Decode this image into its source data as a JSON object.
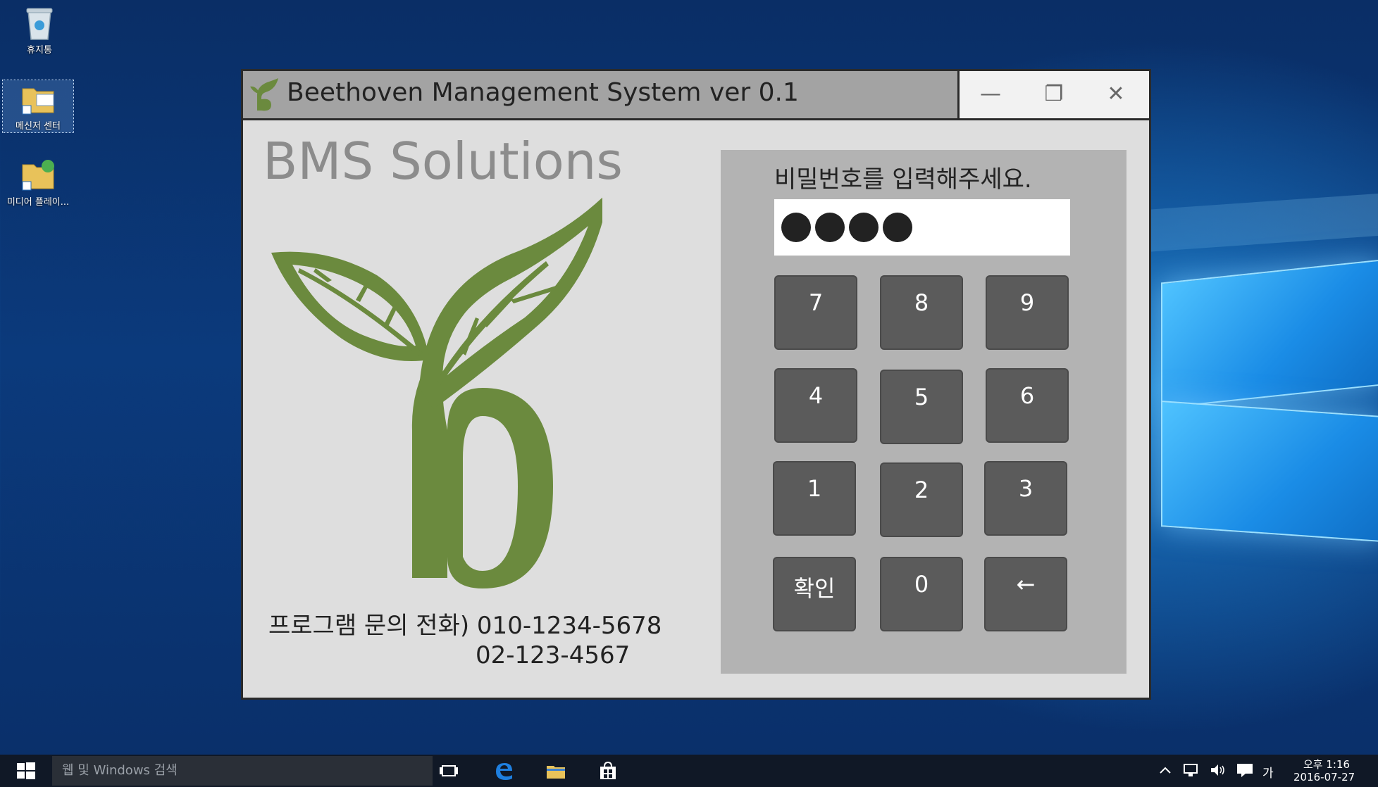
{
  "desktop": {
    "icons": [
      {
        "label": "휴지통",
        "icon": "recycle-bin-icon"
      },
      {
        "label": "메신저 센터",
        "icon": "folder-shortcut-icon"
      },
      {
        "label": "미디어 플레이...",
        "icon": "media-folder-icon"
      }
    ]
  },
  "window": {
    "title": "Beethoven Management System ver 0.1",
    "controls": {
      "minimize": "—",
      "restore": "❐",
      "close": "✕"
    },
    "brand": "BMS Solutions",
    "contact_label": "프로그램 문의 전화) 010-1234-5678",
    "contact_number_2": "02-123-4567",
    "pad": {
      "prompt": "비밀번호를 입력해주세요.",
      "password_dots": 4,
      "keys": [
        {
          "label": "7"
        },
        {
          "label": "8"
        },
        {
          "label": "9"
        },
        {
          "label": "4"
        },
        {
          "label": "5"
        },
        {
          "label": "6"
        },
        {
          "label": "1"
        },
        {
          "label": "2"
        },
        {
          "label": "3"
        },
        {
          "label": "확인"
        },
        {
          "label": "0"
        },
        {
          "label": "←"
        }
      ]
    }
  },
  "taskbar": {
    "search_placeholder": "웹 및 Windows 검색",
    "tray_ime": "가",
    "time": "오후 1:16",
    "date": "2016-07-27"
  },
  "colors": {
    "logo_green": "#6b8a3e",
    "keypad_key": "#5b5b5b",
    "pad_bg": "#b3b3b3"
  }
}
